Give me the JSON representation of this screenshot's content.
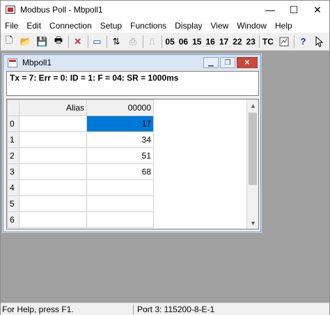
{
  "window": {
    "title": "Modbus Poll - Mbpoll1",
    "minimize": "—",
    "maximize": "☐",
    "close": "✕"
  },
  "menu": [
    "File",
    "Edit",
    "Connection",
    "Setup",
    "Functions",
    "Display",
    "View",
    "Window",
    "Help"
  ],
  "toolbar": {
    "icons": {
      "new": "🗋",
      "open": "📂",
      "save": "💾",
      "print": "🖶",
      "delete": "✕",
      "window": "▭",
      "connect": "⇅",
      "disconnect": "⎙",
      "pulse": "⎍"
    },
    "functions": [
      "05",
      "06",
      "15",
      "16",
      "17",
      "22",
      "23"
    ],
    "tc": "TC",
    "help": "?"
  },
  "child": {
    "title": "Mbpoll1",
    "status": "Tx = 7: Err = 0: ID = 1: F = 04: SR = 1000ms",
    "columns": {
      "alias": "Alias",
      "address": "00000"
    },
    "rows": [
      {
        "index": "0",
        "alias": "",
        "value": "17",
        "selected": true
      },
      {
        "index": "1",
        "alias": "",
        "value": "34"
      },
      {
        "index": "2",
        "alias": "",
        "value": "51"
      },
      {
        "index": "3",
        "alias": "",
        "value": "68"
      },
      {
        "index": "4",
        "alias": "",
        "value": ""
      },
      {
        "index": "5",
        "alias": "",
        "value": ""
      },
      {
        "index": "6",
        "alias": "",
        "value": ""
      }
    ]
  },
  "statusbar": {
    "help": "For Help, press F1.",
    "port": "Port 3: 115200-8-E-1"
  },
  "colors": {
    "selection": "#0078d7",
    "mdi_background": "#a0a0a0",
    "child_title": "#dbe6f4",
    "close_button": "#c94a3a"
  }
}
